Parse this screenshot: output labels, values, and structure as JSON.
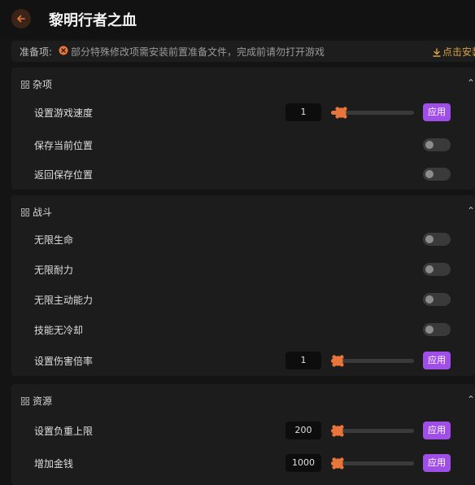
{
  "header": {
    "title": "黎明行者之血"
  },
  "prep": {
    "label": "准备项:",
    "text": "部分特殊修改项需安装前置准备文件，完成前请勿打开游戏",
    "link": "点击安装"
  },
  "sections": [
    {
      "title": "杂项",
      "rows": [
        {
          "label": "设置游戏速度",
          "value": "1",
          "apply": "应用",
          "slider": 0.05
        },
        {
          "label": "保存当前位置",
          "on": false
        },
        {
          "label": "返回保存位置",
          "on": false
        }
      ]
    },
    {
      "title": "战斗",
      "rows": [
        {
          "label": "无限生命",
          "on": false
        },
        {
          "label": "无限耐力",
          "on": false
        },
        {
          "label": "无限主动能力",
          "on": false
        },
        {
          "label": "技能无冷却",
          "on": false
        },
        {
          "label": "设置伤害倍率",
          "value": "1",
          "apply": "应用",
          "slider": 0.0
        }
      ]
    },
    {
      "title": "资源",
      "rows": [
        {
          "label": "设置负重上限",
          "value": "200",
          "apply": "应用",
          "slider": 0.0
        },
        {
          "label": "增加金钱",
          "value": "1000",
          "apply": "应用",
          "slider": 0.0
        }
      ]
    }
  ],
  "colors": {
    "accent": "#e8763a",
    "apply": "#a04ee8",
    "link": "#d9a441"
  }
}
